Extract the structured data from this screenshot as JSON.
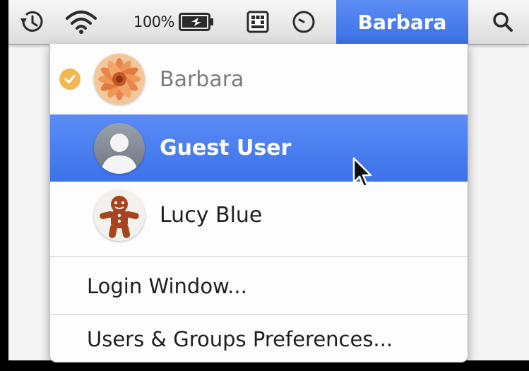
{
  "menubar": {
    "items": [
      {
        "name": "time-machine",
        "icon": "time-machine-icon"
      },
      {
        "name": "wifi",
        "icon": "wifi-icon"
      },
      {
        "name": "battery",
        "icon": "battery-charging-icon",
        "label": "100%"
      },
      {
        "name": "input-method",
        "icon": "keyboard-input-icon"
      },
      {
        "name": "clock",
        "icon": "clock-icon"
      }
    ],
    "user_label": "Barbara",
    "search_icon": "magnifying-glass-icon"
  },
  "user_menu": {
    "users": [
      {
        "name": "Barbara",
        "state": "logged-in",
        "avatar": "flower-avatar"
      },
      {
        "name": "Guest User",
        "state": "highlighted",
        "avatar": "silhouette-avatar"
      },
      {
        "name": "Lucy Blue",
        "state": "normal",
        "avatar": "gingerbread-avatar"
      }
    ],
    "login_window_label": "Login Window...",
    "prefs_label": "Users & Groups Preferences..."
  },
  "colors": {
    "highlight": "#3c72ea",
    "check": "#f3b752",
    "menubar_bg": "#e9e9e9"
  }
}
